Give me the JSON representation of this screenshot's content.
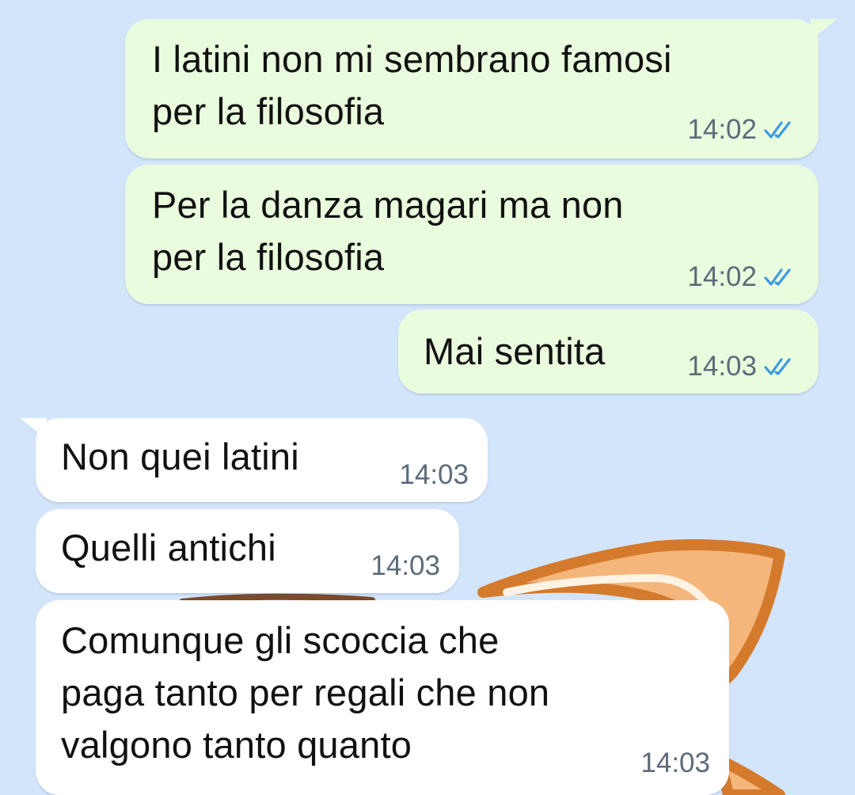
{
  "chat": {
    "messages": [
      {
        "direction": "outgoing",
        "text": "I latini non mi sembrano famosi\nper la filosofia",
        "time": "14:02",
        "status": "read"
      },
      {
        "direction": "outgoing",
        "text": "Per la danza magari ma non\nper la filosofia",
        "time": "14:02",
        "status": "read"
      },
      {
        "direction": "outgoing",
        "text": "Mai sentita",
        "time": "14:03",
        "status": "read"
      },
      {
        "direction": "incoming",
        "text": "Non quei latini",
        "time": "14:03"
      },
      {
        "direction": "incoming",
        "text": "Quelli antichi",
        "time": "14:03"
      },
      {
        "direction": "incoming",
        "text": "Comunque gli scoccia che\npaga tanto per regali che non\nvalgono tanto quanto",
        "time": "14:03"
      }
    ]
  },
  "icons": {
    "read_receipt": "double-check-icon"
  },
  "colors": {
    "background": "#d3e5fb",
    "outgoing_bubble": "#eafcde",
    "incoming_bubble": "#ffffff",
    "timestamp": "#5c6b78",
    "read_check": "#3c9be0",
    "wallpaper_sticker_outline": "#d47a2c",
    "wallpaper_sticker_fill": "#f4b67a"
  }
}
